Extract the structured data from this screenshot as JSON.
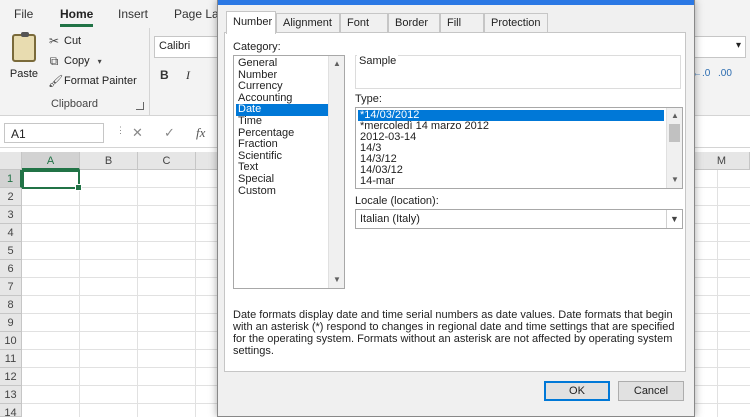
{
  "excel": {
    "ribbon_tabs": [
      "File",
      "Home",
      "Insert",
      "Page Lay"
    ],
    "active_tab": "Home",
    "clipboard": {
      "paste": "Paste",
      "cut": "Cut",
      "copy": "Copy",
      "format_painter": "Format Painter",
      "group_label": "Clipboard"
    },
    "font": {
      "name": "Calibri",
      "bold": "B",
      "italic": "I"
    },
    "name_box": "A1",
    "fx": "fx",
    "columns": [
      "A",
      "B",
      "C",
      "M"
    ],
    "rows": [
      "1",
      "2",
      "3",
      "4",
      "5",
      "6",
      "7",
      "8",
      "9",
      "10",
      "11",
      "12",
      "13",
      "14"
    ],
    "selected_cell": "A1"
  },
  "dialog": {
    "tabs": [
      "Number",
      "Alignment",
      "Font",
      "Border",
      "Fill",
      "Protection"
    ],
    "active_tab": "Number",
    "category_label": "Category:",
    "categories": [
      "General",
      "Number",
      "Currency",
      "Accounting",
      "Date",
      "Time",
      "Percentage",
      "Fraction",
      "Scientific",
      "Text",
      "Special",
      "Custom"
    ],
    "selected_category": "Date",
    "sample_label": "Sample",
    "type_label": "Type:",
    "types": [
      "*14/03/2012",
      "*mercoledì 14 marzo 2012",
      "2012-03-14",
      "14/3",
      "14/3/12",
      "14/03/12",
      "14-mar"
    ],
    "selected_type": "*14/03/2012",
    "locale_label": "Locale (location):",
    "locale_value": "Italian (Italy)",
    "description": "Date formats display date and time serial numbers as date values.  Date formats that begin with an asterisk (*) respond to changes in regional date and time settings that are specified for the operating system. Formats without an asterisk are not affected by operating system settings.",
    "ok_label": "OK",
    "cancel_label": "Cancel"
  },
  "colors": {
    "accent_green": "#217346",
    "selection_blue": "#0078d7"
  }
}
